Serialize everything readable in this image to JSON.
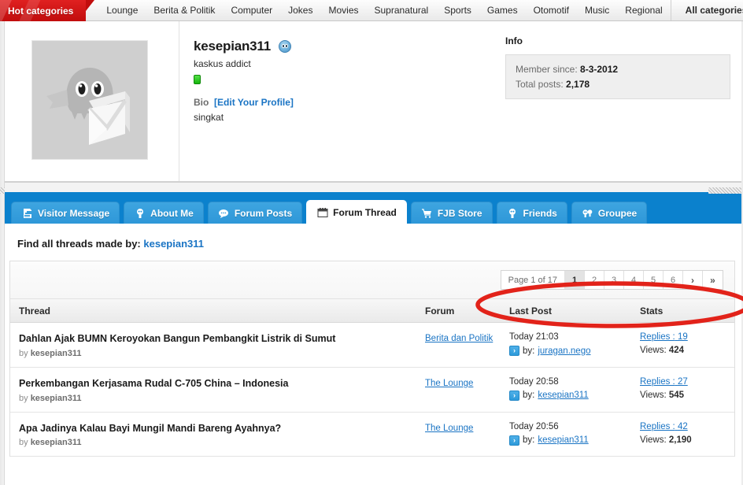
{
  "topnav": {
    "hot_categories_label": "Hot categories",
    "items": [
      "Lounge",
      "Berita & Politik",
      "Computer",
      "Jokes",
      "Movies",
      "Supranatural",
      "Sports",
      "Games",
      "Otomotif",
      "Music",
      "Regional"
    ],
    "all_categories_label": "All categories"
  },
  "profile": {
    "avatar_alt": "default-avatar-placeholder",
    "username": "kesepian311",
    "online_icon": "smiley-face-icon",
    "user_title": "kaskus addict",
    "status": "online",
    "bio_label": "Bio",
    "edit_profile_label": "[Edit Your Profile]",
    "bio_text": "singkat"
  },
  "info": {
    "title": "Info",
    "member_since_label": "Member since:",
    "member_since_value": "8-3-2012",
    "total_posts_label": "Total posts:",
    "total_posts_value": "2,178"
  },
  "tabs": [
    {
      "label": "Visitor Message",
      "icon": "document-lines-icon",
      "active": false
    },
    {
      "label": "About Me",
      "icon": "person-badge-icon",
      "active": false
    },
    {
      "label": "Forum Posts",
      "icon": "speech-bubble-icon",
      "active": false
    },
    {
      "label": "Forum Thread",
      "icon": "calendar-icon",
      "active": true
    },
    {
      "label": "FJB Store",
      "icon": "shopping-cart-icon",
      "active": false
    },
    {
      "label": "Friends",
      "icon": "person-badge-icon",
      "active": false
    },
    {
      "label": "Groupee",
      "icon": "two-people-icon",
      "active": false
    }
  ],
  "find_all": {
    "prefix": "Find all threads made by:",
    "username": "kesepian311"
  },
  "pager": {
    "page_label": "Page 1 of 17",
    "pages": [
      "1",
      "2",
      "3",
      "4",
      "5",
      "6"
    ],
    "current": "1",
    "next_icon": "›",
    "last_icon": "»"
  },
  "table": {
    "headers": {
      "thread": "Thread",
      "forum": "Forum",
      "last_post": "Last Post",
      "stats": "Stats"
    },
    "rows": [
      {
        "title": "Dahlan Ajak BUMN Keroyokan Bangun Pembangkit Listrik di Sumut",
        "by_prefix": "by",
        "by_user": "kesepian311",
        "forum": "Berita dan Politik",
        "last_post_time": "Today 21:03",
        "last_post_by_prefix": "by:",
        "last_post_by_user": "juragan.nego",
        "replies_label": "Replies :",
        "replies_value": "19",
        "views_label": "Views:",
        "views_value": "424"
      },
      {
        "title": "Perkembangan Kerjasama Rudal C-705 China – Indonesia",
        "by_prefix": "by",
        "by_user": "kesepian311",
        "forum": "The Lounge",
        "last_post_time": "Today 20:58",
        "last_post_by_prefix": "by:",
        "last_post_by_user": "kesepian311",
        "replies_label": "Replies :",
        "replies_value": "27",
        "views_label": "Views:",
        "views_value": "545"
      },
      {
        "title": "Apa Jadinya Kalau Bayi Mungil Mandi Bareng Ayahnya?",
        "by_prefix": "by",
        "by_user": "kesepian311",
        "forum": "The Lounge",
        "last_post_time": "Today 20:56",
        "last_post_by_prefix": "by:",
        "last_post_by_user": "kesepian311",
        "replies_label": "Replies :",
        "replies_value": "42",
        "views_label": "Views:",
        "views_value": "2,190"
      }
    ]
  },
  "annotation": {
    "shape": "red-ellipse-highlight",
    "color": "#e2231a",
    "target": "pagination-control"
  },
  "colors": {
    "hot_red": "#c10d0d",
    "tab_blue": "#0b81cd",
    "link_blue": "#1a74c4",
    "annotation_red": "#e2231a"
  }
}
